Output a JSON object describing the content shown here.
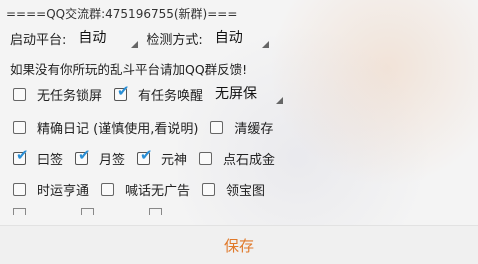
{
  "header": {
    "group_text": "====QQ交流群:475196755(新群)==="
  },
  "settings": {
    "platform_label": "启动平台:",
    "platform_value": "自动",
    "detect_label": "检测方式:",
    "detect_value": "自动",
    "note": "如果没有你所玩的乱斗平台请加QQ群反馈!"
  },
  "options": [
    {
      "label": "无任务锁屏",
      "checked": false
    },
    {
      "label": "有任务唤醒",
      "checked": true
    },
    {
      "label": "精确日记 (谨慎使用,看说明)",
      "checked": false
    },
    {
      "label": "清缓存",
      "checked": false
    },
    {
      "label": "曰签",
      "checked": true
    },
    {
      "label": "月签",
      "checked": true
    },
    {
      "label": "元神",
      "checked": true
    },
    {
      "label": "点石成金",
      "checked": false
    },
    {
      "label": "时运亨通",
      "checked": false
    },
    {
      "label": "喊话无广告",
      "checked": false
    },
    {
      "label": "领宝图",
      "checked": false
    }
  ],
  "screen_mode": {
    "value": "无屏保"
  },
  "footer": {
    "save_label": "保存"
  },
  "colors": {
    "check": "#2a8fd6",
    "save": "#e0792a"
  }
}
